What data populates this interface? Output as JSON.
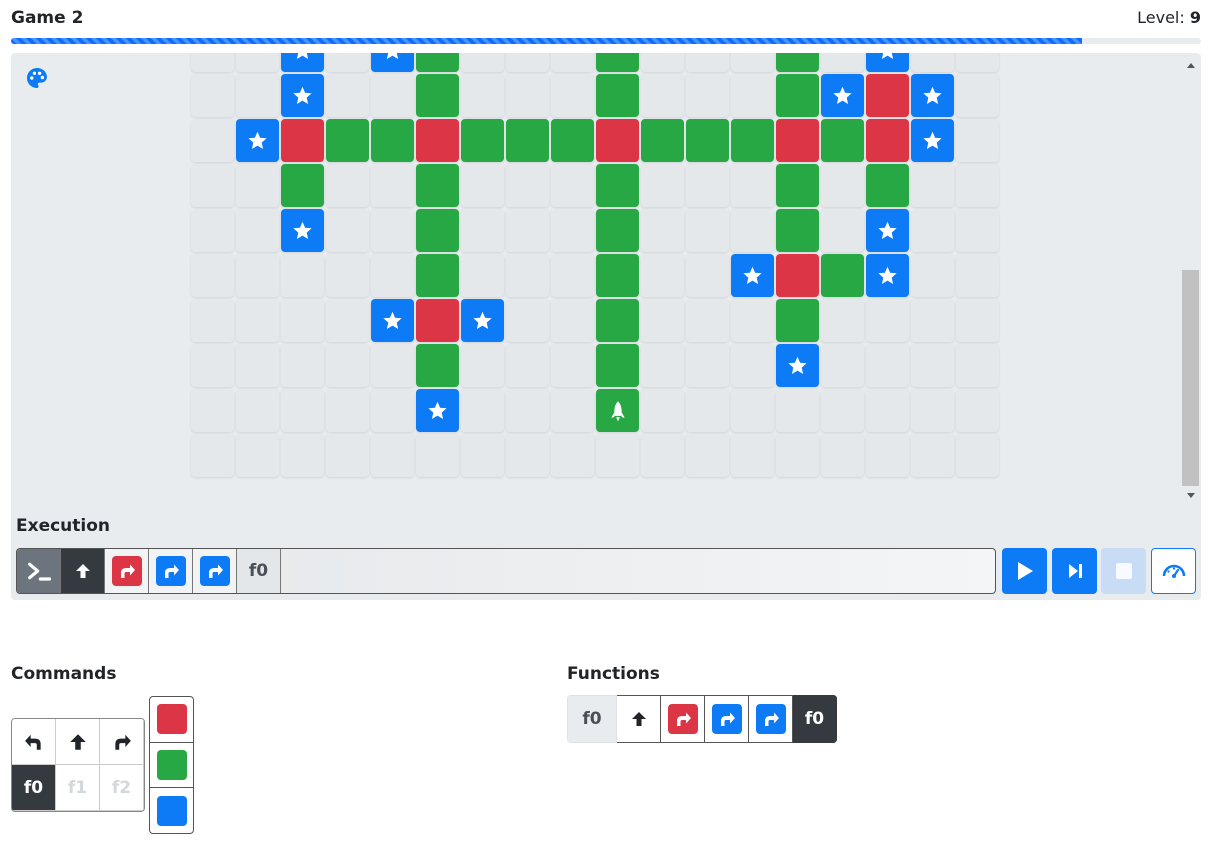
{
  "header": {
    "game_title": "Game 2",
    "level_label": "Level:",
    "level_value": "9"
  },
  "progress": {
    "fraction": 0.9
  },
  "board": {
    "columns": 18,
    "legend": {
      ".": "empty",
      "G": "green",
      "R": "red",
      "S": "blue-star",
      "P": "green-rocket"
    },
    "rows": [
      "..S.SG...G...G.S..",
      "..S..G...G...GSRS.",
      ".SRGGRGGGRGGGRGRS.",
      "..G..G...G...G.G..",
      "..S..G...G...G.S..",
      ".....G...G..SRGS..",
      "....SRS..G...G....",
      ".....G...G...S....",
      ".....S...P........",
      ".................."
    ]
  },
  "execution": {
    "title": "Execution",
    "items": [
      {
        "kind": "terminal",
        "icon": "terminal-icon"
      },
      {
        "kind": "forward",
        "icon": "arrow-up-icon",
        "active": true
      },
      {
        "kind": "turn-right",
        "color": "red",
        "icon": "turn-right-icon"
      },
      {
        "kind": "turn-right",
        "color": "blue",
        "icon": "turn-right-icon"
      },
      {
        "kind": "turn-right",
        "color": "blue",
        "icon": "turn-right-icon"
      },
      {
        "kind": "call",
        "label": "f0"
      }
    ],
    "controls": [
      {
        "name": "play-button",
        "icon": "play-icon",
        "enabled": true
      },
      {
        "name": "step-button",
        "icon": "step-forward-icon",
        "enabled": true
      },
      {
        "name": "stop-button",
        "icon": "stop-icon",
        "enabled": false
      },
      {
        "name": "speed-button",
        "icon": "speedometer-icon",
        "enabled": true
      }
    ]
  },
  "commands": {
    "title": "Commands",
    "moves": [
      "turn-left-icon",
      "arrow-up-icon",
      "turn-right-icon"
    ],
    "functions": [
      "f0",
      "f1",
      "f2"
    ],
    "active_function": "f0",
    "colors": [
      "#dc3545",
      "#28a745",
      "#0d7bf6"
    ]
  },
  "functions": {
    "title": "Functions",
    "rows": [
      {
        "label": "f0",
        "items": [
          {
            "kind": "forward",
            "icon": "arrow-up-icon"
          },
          {
            "kind": "turn-right",
            "color": "red",
            "icon": "turn-right-icon"
          },
          {
            "kind": "turn-right",
            "color": "blue",
            "icon": "turn-right-icon"
          },
          {
            "kind": "turn-right",
            "color": "blue",
            "icon": "turn-right-icon"
          },
          {
            "kind": "call",
            "label": "f0"
          }
        ]
      }
    ]
  },
  "colors": {
    "green": "#28a745",
    "red": "#dc3545",
    "blue": "#0d7bf6",
    "dark": "#343a40"
  }
}
